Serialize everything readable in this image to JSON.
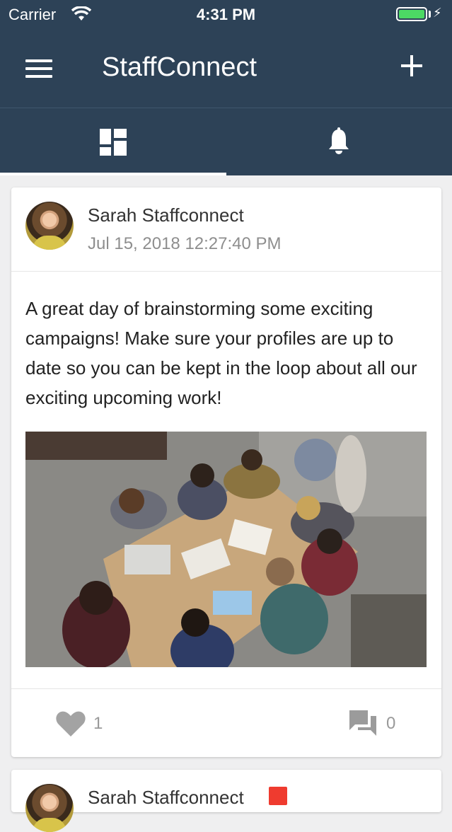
{
  "status_bar": {
    "carrier": "Carrier",
    "time": "4:31 PM",
    "battery_color": "#4cd964"
  },
  "header": {
    "title": "StaffConnect",
    "menu_icon": "hamburger-menu-icon",
    "add_icon": "plus-icon",
    "background": "#2d4257"
  },
  "tabs": [
    {
      "icon": "dashboard-grid-icon",
      "active": true
    },
    {
      "icon": "bell-icon",
      "active": false
    }
  ],
  "feed": {
    "posts": [
      {
        "author": "Sarah Staffconnect",
        "timestamp": "Jul 15, 2018 12:27:40 PM",
        "text": "A great day of brainstorming some exciting campaigns! Make sure your profiles are up to date so you can be kept in the loop about all our exciting upcoming work!",
        "image": "overhead photo of team meeting around a table",
        "likes": "1",
        "comments": "0"
      },
      {
        "author": "Sarah Staffconnect"
      }
    ]
  }
}
